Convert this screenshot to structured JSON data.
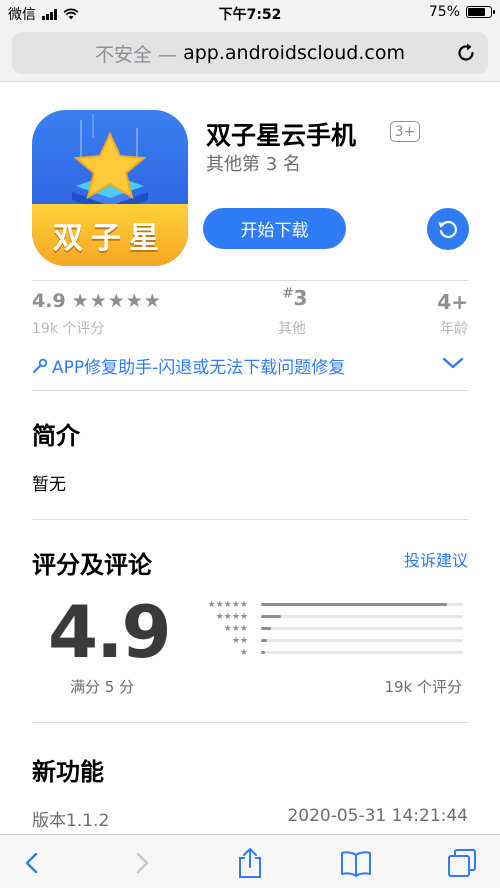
{
  "status_bar": {
    "carrier": "微信",
    "time": "下午7:52",
    "battery": "75%",
    "battery_level": 0.75
  },
  "url_bar": {
    "security_label": "不安全 —",
    "host": "app.androidscloud.com"
  },
  "app": {
    "icon_text": "双子星",
    "title": "双子星云手机",
    "age_badge": "3+",
    "rank_line": "其他第 3 名",
    "download_label": "开始下载"
  },
  "stats": {
    "rating": "4.9",
    "stars": "★★★★★",
    "rating_count": "19k 个评分",
    "rank_prefix": "#",
    "rank": "3",
    "rank_label": "其他",
    "age": "4+",
    "age_label": "年龄"
  },
  "repair_link": "APP修复助手-闪退或无法下载问题修复",
  "intro": {
    "title": "简介",
    "text": "暂无"
  },
  "ratings": {
    "title": "评分及评论",
    "report_link": "投诉建议",
    "score": "4.9",
    "max_label": "满分 5 分",
    "count": "19k 个评分",
    "distribution": [
      {
        "stars": "★★★★★",
        "fraction": 0.92
      },
      {
        "stars": "★★★★",
        "fraction": 0.1
      },
      {
        "stars": "★★★",
        "fraction": 0.05
      },
      {
        "stars": "★★",
        "fraction": 0.03
      },
      {
        "stars": "★",
        "fraction": 0.02
      }
    ]
  },
  "whats_new": {
    "title": "新功能",
    "version": "版本1.1.2",
    "date": "2020-05-31 14:21:44"
  },
  "colors": {
    "accent": "#2f7cf6",
    "secondary_text": "#8e8e93"
  },
  "toolbar": {
    "icons": [
      "back-icon",
      "forward-icon",
      "share-icon",
      "bookmarks-icon",
      "tabs-icon"
    ]
  }
}
